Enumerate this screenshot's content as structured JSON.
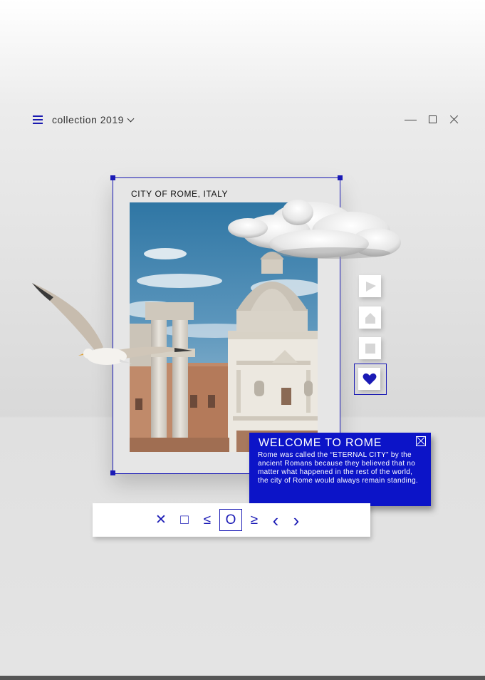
{
  "header": {
    "collection_label": "collection 2019"
  },
  "photo": {
    "title": "CITY OF ROME, ITALY"
  },
  "card": {
    "title": "WELCOME TO ROME",
    "body": "Rome was called the “ETERNAL CITY” by the ancient Romans because they believed that no matter what happened in the rest of the world, the city of Rome would always remain standing."
  },
  "toolbar": {
    "close_symbol": "✕",
    "square_symbol": "□",
    "less_equal_symbol": "≤",
    "circle_symbol": "O",
    "greater_equal_symbol": "≥",
    "prev_symbol": "‹",
    "next_symbol": "›"
  },
  "colors": {
    "accent": "#1a1ab5",
    "card_bg": "#0c14c8"
  },
  "icons": [
    "menu-icon",
    "chevron-down-icon",
    "minimize-icon",
    "maximize-icon",
    "close-icon",
    "play-icon",
    "home-icon",
    "stop-icon",
    "heart-icon"
  ]
}
